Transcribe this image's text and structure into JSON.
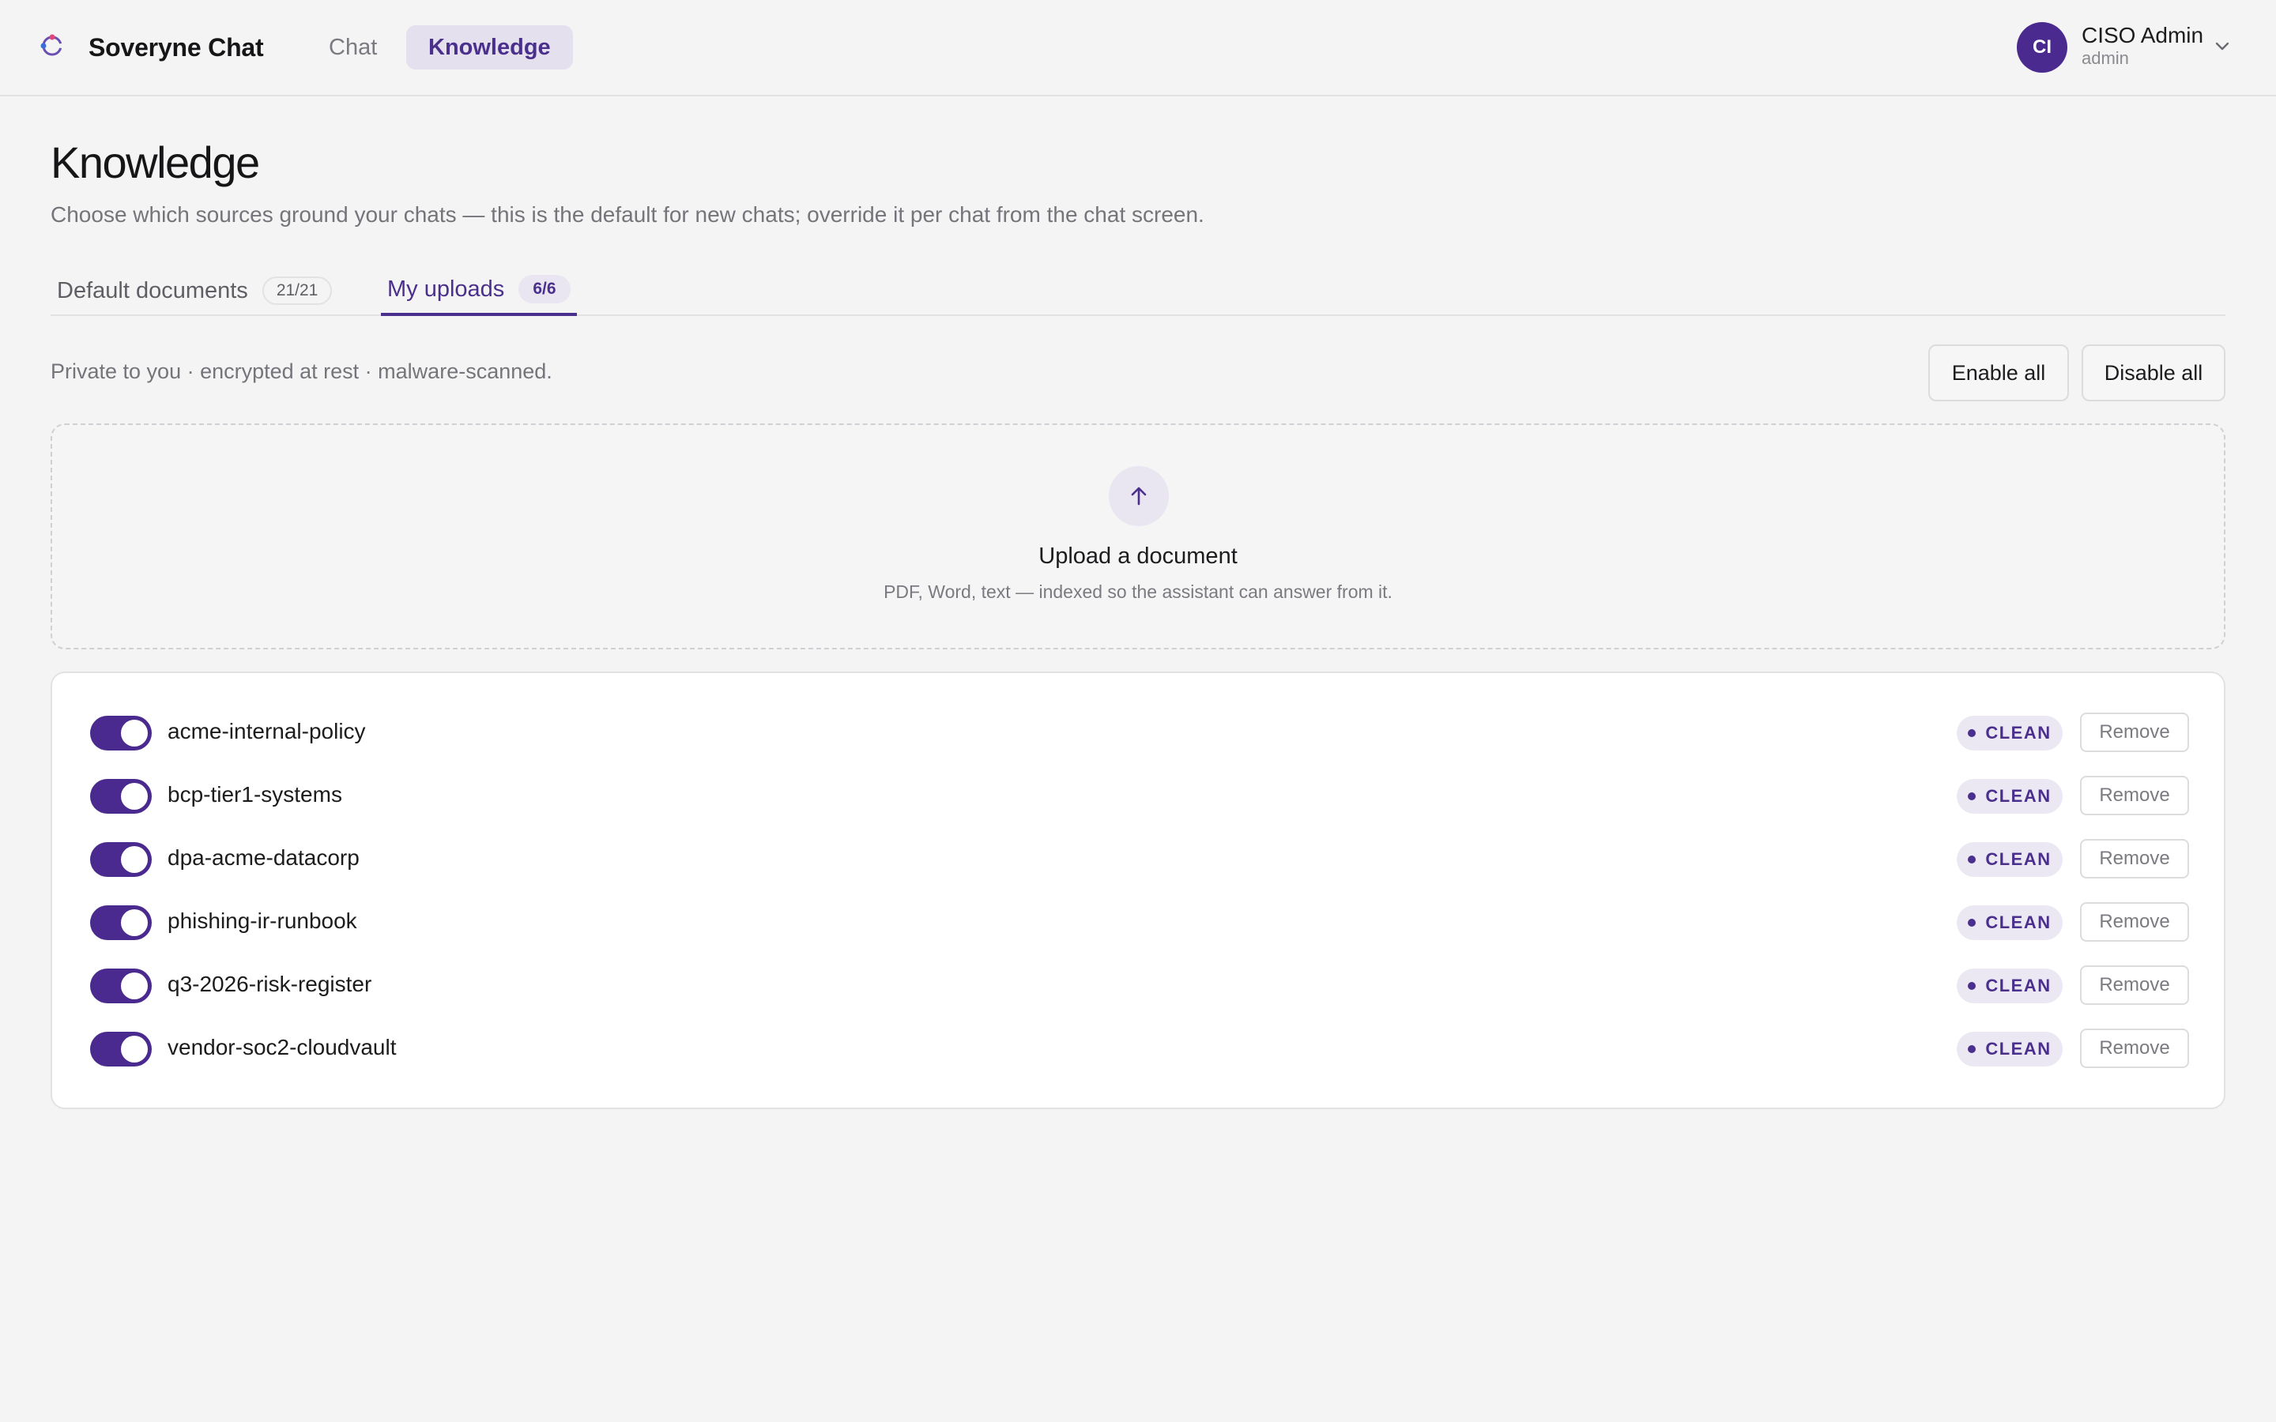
{
  "app": {
    "brand": "Soveryne Chat",
    "accent_color": "#4b2a8f",
    "nav": [
      {
        "label": "Chat",
        "active": false
      },
      {
        "label": "Knowledge",
        "active": true
      }
    ],
    "user": {
      "initials": "CI",
      "name": "CISO Admin",
      "role": "admin"
    }
  },
  "page": {
    "title": "Knowledge",
    "subtitle": "Choose which sources ground your chats — this is the default for new chats; override it per chat from the chat screen.",
    "tabs": [
      {
        "label": "Default documents",
        "count": "21/21",
        "active": false
      },
      {
        "label": "My uploads",
        "count": "6/6",
        "active": true
      }
    ],
    "privacy_note": "Private to you · encrypted at rest · malware-scanned.",
    "enable_all_label": "Enable all",
    "disable_all_label": "Disable all"
  },
  "upload": {
    "icon": "arrow-up-icon",
    "title": "Upload a document",
    "hint": "PDF, Word, text — indexed so the assistant can answer from it."
  },
  "documents": [
    {
      "name": "acme-internal-policy",
      "enabled": true,
      "status": "CLEAN",
      "remove_label": "Remove"
    },
    {
      "name": "bcp-tier1-systems",
      "enabled": true,
      "status": "CLEAN",
      "remove_label": "Remove"
    },
    {
      "name": "dpa-acme-datacorp",
      "enabled": true,
      "status": "CLEAN",
      "remove_label": "Remove"
    },
    {
      "name": "phishing-ir-runbook",
      "enabled": true,
      "status": "CLEAN",
      "remove_label": "Remove"
    },
    {
      "name": "q3-2026-risk-register",
      "enabled": true,
      "status": "CLEAN",
      "remove_label": "Remove"
    },
    {
      "name": "vendor-soc2-cloudvault",
      "enabled": true,
      "status": "CLEAN",
      "remove_label": "Remove"
    }
  ]
}
